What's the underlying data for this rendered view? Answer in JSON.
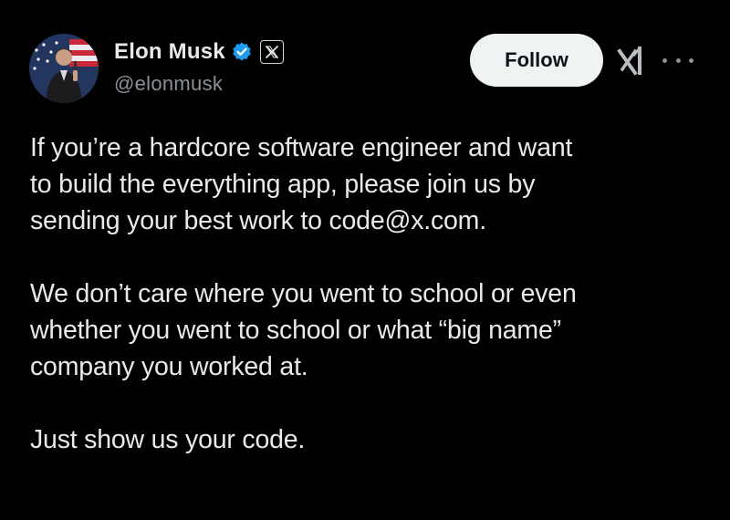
{
  "author": {
    "display_name": "Elon Musk",
    "handle": "@elonmusk",
    "verified_icon": "verified-check-icon",
    "affiliate_icon": "x-logo-icon"
  },
  "actions": {
    "follow_label": "Follow",
    "grok_icon": "grok-icon",
    "more_icon": "more-options-icon"
  },
  "tweet": {
    "paragraphs": [
      "If you’re a hardcore software engineer and want\nto build the everything app, please join us by\nsending your best work to code@x.com.",
      "We don’t care where you went to school or even\nwhether you went to school or what “big name”\ncompany you worked at.",
      "Just show us your code."
    ]
  },
  "colors": {
    "background": "#000000",
    "text_primary": "#e7e9ea",
    "text_secondary": "#8b9197",
    "verified_blue": "#1d9bf0",
    "follow_bg": "#eff3f4"
  }
}
